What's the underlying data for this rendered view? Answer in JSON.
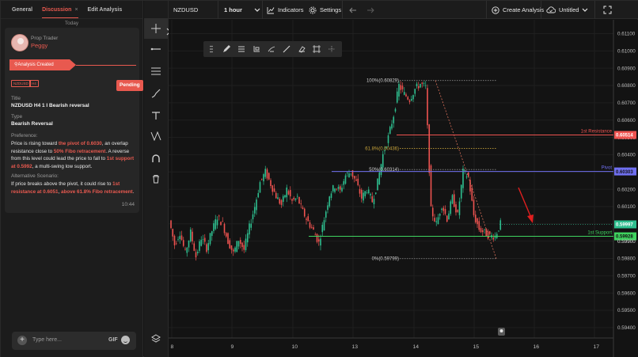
{
  "left_panel": {
    "tabs": [
      {
        "label": "General",
        "active": false
      },
      {
        "label": "Discussion",
        "active": true
      },
      {
        "label": "Edit Analysis",
        "active": false
      }
    ],
    "today_label": "Today",
    "message": {
      "author_name": "Prop Trader",
      "author_username": "Peggy",
      "banner": "Analysis Created",
      "badges": [
        "NZDUSD",
        "H4"
      ],
      "status": "Pending",
      "title_label": "Title",
      "title_value": "NZDUSD H4 1 I Bearish reversal",
      "type_label": "Type",
      "type_value": "Bearish Reversal",
      "preference_label": "Preference:",
      "preference_parts": [
        {
          "t": "Price is rising toward ",
          "hl": false
        },
        {
          "t": "the pivot of 0.6030",
          "hl": true
        },
        {
          "t": ", an overlap resistance close to ",
          "hl": false
        },
        {
          "t": "50% Fibo retracement",
          "hl": true
        },
        {
          "t": ". A reverse from this level could lead the price to fall to ",
          "hl": false
        },
        {
          "t": "1st support at 0.5992",
          "hl": true
        },
        {
          "t": ", a multi-swing low support.",
          "hl": false
        }
      ],
      "alternative_label": "Alternative Scenario:",
      "alternative_parts": [
        {
          "t": "If price breaks above the pivot, it could rise to ",
          "hl": false
        },
        {
          "t": "1st resistance at 0.6051",
          "hl": true
        },
        {
          "t": ", ",
          "hl": false
        },
        {
          "t": "above 61.8% Fibo retracement",
          "hl": true
        },
        {
          "t": ".",
          "hl": false
        }
      ],
      "time": "10:44"
    },
    "composer": {
      "placeholder": "Type here...",
      "gif_label": "GIF"
    }
  },
  "topbar": {
    "symbol": "NZDUSD",
    "interval": "1 hour",
    "indicators_label": "Indicators",
    "settings_label": "Settings",
    "create_label": "Create Analysis",
    "title_label": "Untitled"
  },
  "tools": [
    "crosshair-icon",
    "horizontal-line-icon",
    "parallel-lines-icon",
    "brush-icon",
    "text-icon",
    "pattern-icon",
    "magnet-icon",
    "trash-icon",
    "layers-icon"
  ],
  "drawbar_tools": [
    "drag-handle-icon",
    "pencil-icon",
    "lines-icon",
    "fill-icon",
    "style-icon",
    "line-width-icon",
    "eraser-icon",
    "frame-icon",
    "more-icon"
  ],
  "colors": {
    "accent": "#e8594f",
    "up": "#2ebf8f",
    "down": "#ef5350",
    "resistance": "#ef5350",
    "pivot": "#6f6ff0",
    "support": "#3fd35f",
    "fib": "#c7a33a"
  },
  "chart_data": {
    "type": "candlestick",
    "symbol": "NZDUSD",
    "ylim": [
      0.5934,
      0.6118
    ],
    "y_ticks": [
      "0.61100",
      "0.61000",
      "0.60900",
      "0.60800",
      "0.60700",
      "0.60600",
      "0.60500",
      "0.60400",
      "0.60300",
      "0.60200",
      "0.60100",
      "0.60000",
      "0.59900",
      "0.59800",
      "0.59700",
      "0.59600",
      "0.59500",
      "0.59400"
    ],
    "x_ticks": [
      "8",
      "9",
      "10",
      "13",
      "14",
      "15",
      "16",
      "17"
    ],
    "levels": [
      {
        "name": "1st Resistance",
        "value": 0.60514,
        "label": "0.60514",
        "color": "#ef5350"
      },
      {
        "name": "Pivot",
        "value": 0.60303,
        "label": "0.60303",
        "color": "#6f6ff0"
      },
      {
        "name": "1st Support",
        "value": 0.59928,
        "label": "0.59928",
        "color": "#3fd35f"
      }
    ],
    "current_price": {
      "value": 0.59997,
      "label": "0.59997"
    },
    "extra_axis_label": "0.59900",
    "fibonacci": [
      {
        "label": "100%(0.60829)",
        "value": 0.60829
      },
      {
        "label": "61.8%(0.60436)",
        "value": 0.60436
      },
      {
        "label": "50%(0.60314)",
        "value": 0.60314
      },
      {
        "label": "0%(0.59799)",
        "value": 0.59799
      }
    ],
    "path_points": [
      [
        0,
        0.6002
      ],
      [
        3,
        0.5988
      ],
      [
        6,
        0.5995
      ],
      [
        9,
        0.5983
      ],
      [
        12,
        0.5995
      ],
      [
        15,
        0.5981
      ],
      [
        18,
        0.5992
      ],
      [
        21,
        0.5986
      ],
      [
        24,
        0.5996
      ],
      [
        27,
        0.6004
      ],
      [
        30,
        0.6
      ],
      [
        33,
        0.599
      ],
      [
        36,
        0.5983
      ],
      [
        39,
        0.5991
      ],
      [
        42,
        0.5985
      ],
      [
        45,
        0.5998
      ],
      [
        48,
        0.601
      ],
      [
        51,
        0.6024
      ],
      [
        54,
        0.603
      ],
      [
        57,
        0.6023
      ],
      [
        60,
        0.6016
      ],
      [
        63,
        0.6011
      ],
      [
        66,
        0.602
      ],
      [
        69,
        0.6013
      ],
      [
        72,
        0.6015
      ],
      [
        75,
        0.6007
      ],
      [
        78,
        0.6001
      ],
      [
        81,
        0.5996
      ],
      [
        84,
        0.5989
      ],
      [
        87,
        0.6003
      ],
      [
        90,
        0.6017
      ],
      [
        93,
        0.6022
      ],
      [
        96,
        0.6019
      ],
      [
        99,
        0.6028
      ],
      [
        102,
        0.603
      ],
      [
        105,
        0.6024
      ],
      [
        108,
        0.6015
      ],
      [
        111,
        0.602
      ],
      [
        114,
        0.6013
      ],
      [
        117,
        0.6024
      ],
      [
        120,
        0.604
      ],
      [
        123,
        0.605
      ],
      [
        126,
        0.6063
      ],
      [
        129,
        0.608
      ],
      [
        132,
        0.6075
      ],
      [
        135,
        0.6072
      ],
      [
        138,
        0.6078
      ],
      [
        141,
        0.6081
      ],
      [
        144,
        0.6079
      ],
      [
        147,
        0.6008
      ],
      [
        150,
        0.6
      ],
      [
        153,
        0.6011
      ],
      [
        156,
        0.6003
      ],
      [
        159,
        0.6015
      ],
      [
        162,
        0.6005
      ],
      [
        165,
        0.603
      ],
      [
        168,
        0.6027
      ],
      [
        171,
        0.6005
      ],
      [
        174,
        0.5997
      ],
      [
        177,
        0.5995
      ],
      [
        180,
        0.5993
      ],
      [
        183,
        0.5993
      ],
      [
        186,
        0.6
      ]
    ],
    "arrow": {
      "direction": "down",
      "color": "#e01f1f"
    }
  }
}
